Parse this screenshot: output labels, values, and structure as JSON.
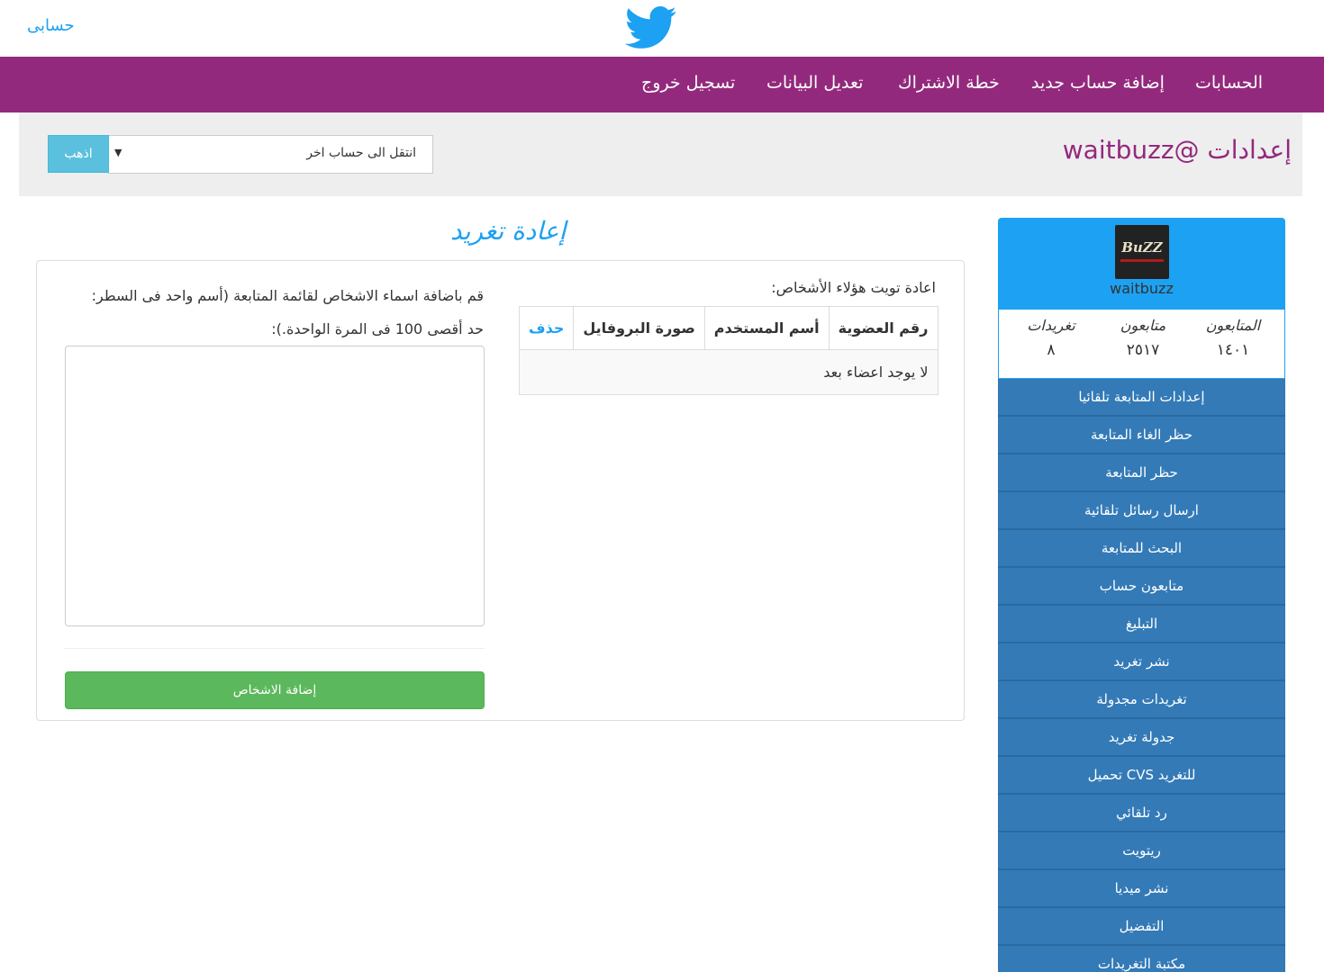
{
  "header": {
    "my_account": "حسابى",
    "logo_icon": "twitter-bird-icon"
  },
  "nav": {
    "items": [
      "الحسابات",
      "إضافة حساب جديد",
      "خطة الاشتراك",
      "تعديل البيانات",
      "تسجيل خروج"
    ]
  },
  "settings": {
    "title": "إعدادات @waitbuzz",
    "switch_account_placeholder": "انتقل الى حساب اخر",
    "go_label": "اذهب"
  },
  "section": {
    "title": "إعادة تغريد"
  },
  "retweet": {
    "label": "اعادة تويت هؤلاء الأشخاص:",
    "table": {
      "headers": [
        "رقم العضوية",
        "أسم المستخدم",
        "صورة البروفايل",
        "حذف"
      ],
      "empty_message": "لا يوجد اعضاء بعد"
    },
    "instructions_line1": "قم باضافة اسماء الاشخاص لقائمة المتابعة (أسم واحد فى السطر:",
    "instructions_line2": "حد أقصى 100 فى المرة الواحدة.):",
    "names_value": "",
    "add_button": "إضافة الاشخاص"
  },
  "profile": {
    "username": "waitbuzz",
    "stats": {
      "followers_label": "المتابعون",
      "followers_value": "١٤٠١",
      "following_label": "متابعون",
      "following_value": "٢٥١٧",
      "tweets_label": "تغريدات",
      "tweets_value": "٨"
    }
  },
  "sidebar": {
    "items": [
      "إعدادات المتابعة تلقائيا",
      "حظر الغاء المتابعة",
      "حظر المتابعة",
      "ارسال رسائل تلقائية",
      "البحث للمتابعة",
      "متابعون حساب",
      "التبليغ",
      "نشر تغريد",
      "تغريدات مجدولة",
      "جدولة تغريد",
      "تحميل CVS للتغريد",
      "رد تلقائي",
      "ريتويت",
      "نشر ميديا",
      "التفضيل",
      "مكتبة التغريدات"
    ]
  }
}
